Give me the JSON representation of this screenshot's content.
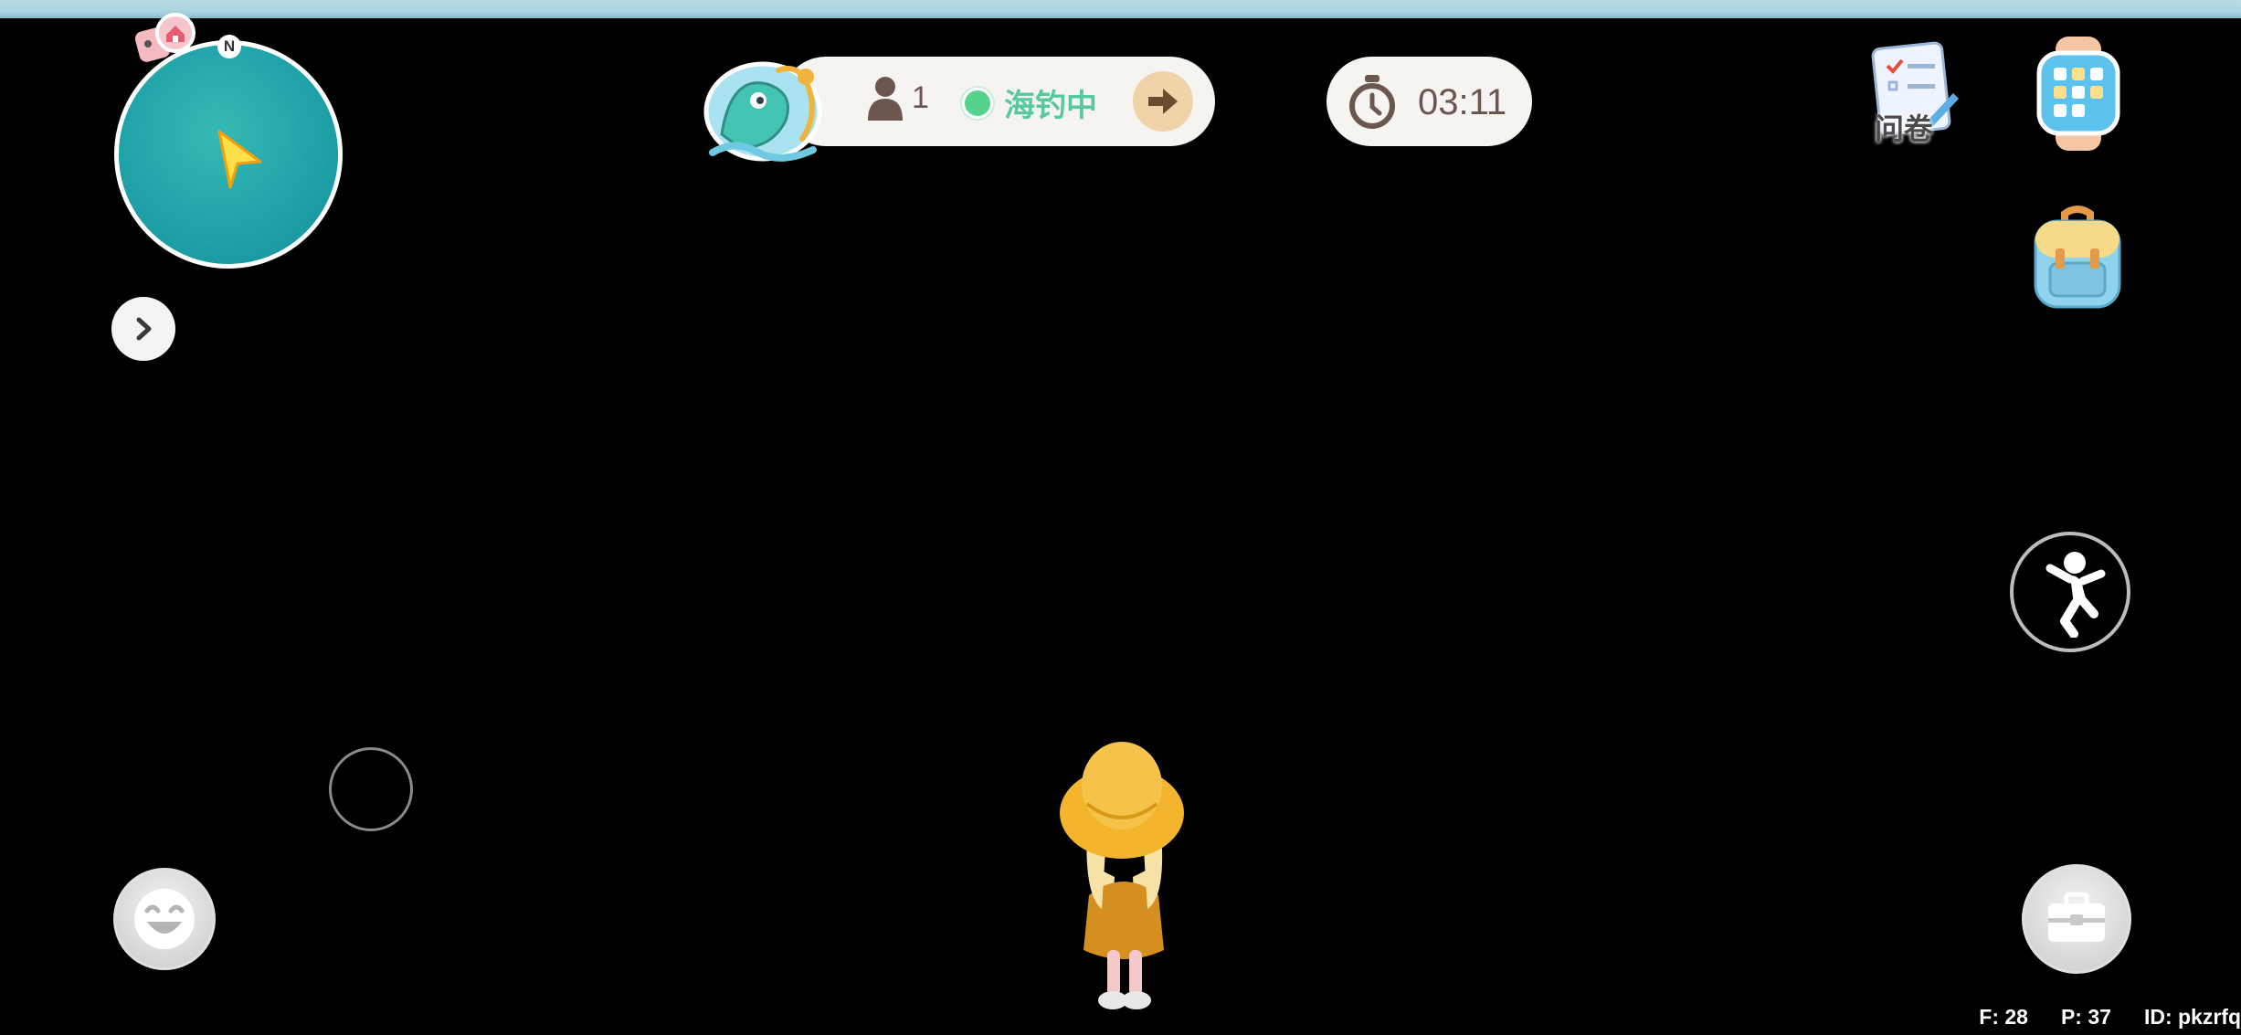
{
  "minimap": {
    "compass": "N"
  },
  "fishing": {
    "player_count": "1",
    "status": "海钓中"
  },
  "timer": {
    "value": "03:11"
  },
  "survey": {
    "label": "问卷"
  },
  "stats": {
    "f": "F: 28",
    "p": "P: 37",
    "id": "ID: pkzrfq"
  },
  "colors": {
    "minimap": "#1fa3a8",
    "status": "#58c99a",
    "pill": "#f6f4f0"
  }
}
